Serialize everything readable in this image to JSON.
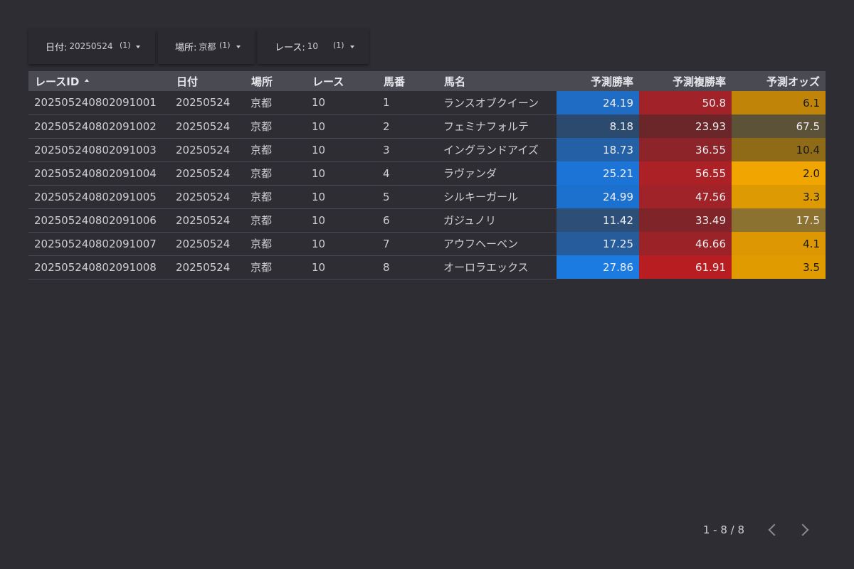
{
  "filters": [
    {
      "label": "日付:",
      "value": "20250524",
      "count": "(1)"
    },
    {
      "label": "場所:",
      "value": "京都",
      "count": "(1)"
    },
    {
      "label": "レース:",
      "value": "10",
      "count": "(1)"
    }
  ],
  "table": {
    "headers": [
      "レースID",
      "日付",
      "場所",
      "レース",
      "馬番",
      "馬名",
      "予測勝率",
      "予測複勝率",
      "予測オッズ"
    ],
    "sort_column": "レースID",
    "sort_direction": "ascending",
    "rows": [
      {
        "id": "202505240802091001",
        "date": "20250524",
        "place": "京都",
        "race": "10",
        "num": "1",
        "name": "ランスオブクイーン",
        "win": "24.19",
        "show": "50.8",
        "odds": "6.1"
      },
      {
        "id": "202505240802091002",
        "date": "20250524",
        "place": "京都",
        "race": "10",
        "num": "2",
        "name": "フェミナフォルテ",
        "win": "8.18",
        "show": "23.93",
        "odds": "67.5"
      },
      {
        "id": "202505240802091003",
        "date": "20250524",
        "place": "京都",
        "race": "10",
        "num": "3",
        "name": "イングランドアイズ",
        "win": "18.73",
        "show": "36.55",
        "odds": "10.4"
      },
      {
        "id": "202505240802091004",
        "date": "20250524",
        "place": "京都",
        "race": "10",
        "num": "4",
        "name": "ラヴァンダ",
        "win": "25.21",
        "show": "56.55",
        "odds": "2.0"
      },
      {
        "id": "202505240802091005",
        "date": "20250524",
        "place": "京都",
        "race": "10",
        "num": "5",
        "name": "シルキーガール",
        "win": "24.99",
        "show": "47.56",
        "odds": "3.3"
      },
      {
        "id": "202505240802091006",
        "date": "20250524",
        "place": "京都",
        "race": "10",
        "num": "6",
        "name": "ガジュノリ",
        "win": "11.42",
        "show": "33.49",
        "odds": "17.5"
      },
      {
        "id": "202505240802091007",
        "date": "20250524",
        "place": "京都",
        "race": "10",
        "num": "7",
        "name": "アウフヘーベン",
        "win": "17.25",
        "show": "46.66",
        "odds": "4.1"
      },
      {
        "id": "202505240802091008",
        "date": "20250524",
        "place": "京都",
        "race": "10",
        "num": "8",
        "name": "オーロラエックス",
        "win": "27.86",
        "show": "61.91",
        "odds": "3.5"
      }
    ],
    "cell_colors": {
      "win": [
        "#1e6cc4",
        "#2b4a6e",
        "#2460a6",
        "#1c74d6",
        "#1c71cf",
        "#2d4e77",
        "#275c9c",
        "#1b7be0"
      ],
      "show": [
        "#a12228",
        "#6a2628",
        "#8c2429",
        "#ac2126",
        "#9f2328",
        "#7f2529",
        "#9b2328",
        "#b81d22"
      ],
      "odds": [
        "#bf8408",
        "#5c5238",
        "#8f6b17",
        "#f0a500",
        "#dd9a02",
        "#8b7230",
        "#dc9702",
        "#e09b00"
      ],
      "odds_dark_text_rows": [
        0,
        2,
        3,
        4,
        6,
        7
      ]
    }
  },
  "pager": {
    "range": "1 - 8 / 8"
  }
}
